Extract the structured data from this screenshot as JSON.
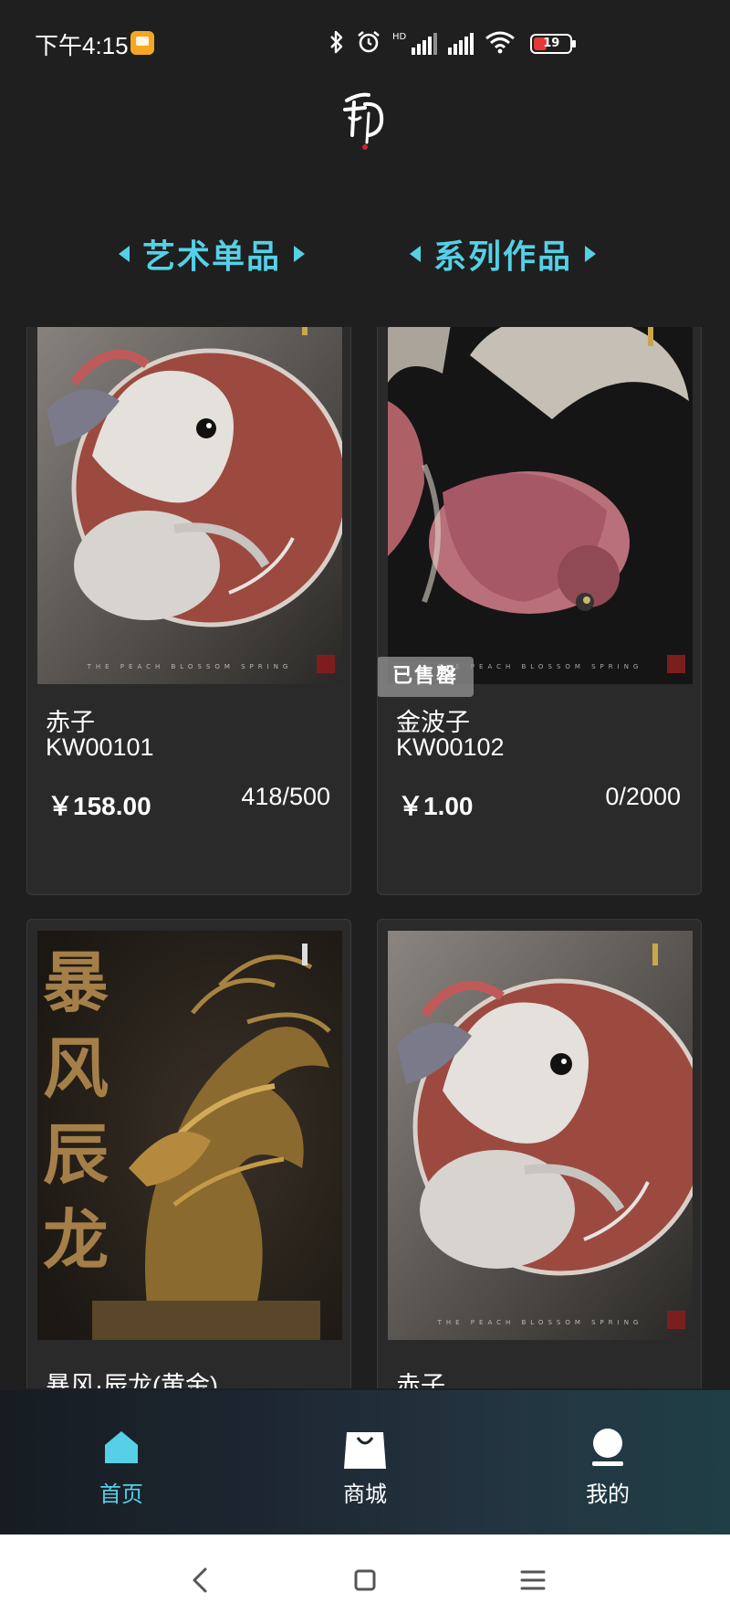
{
  "status_bar": {
    "time": "下午4:15",
    "hd_label": "HD",
    "battery_level": "19",
    "battery_color": "#e53935"
  },
  "tabs": [
    {
      "label": "艺术单品"
    },
    {
      "label": "系列作品"
    }
  ],
  "accent_color": "#55d0e6",
  "products": [
    {
      "name": "赤子",
      "code": "KW00101",
      "price": "￥158.00",
      "stock": "418/500",
      "image": "white-dragon-spirit-artwork"
    },
    {
      "name": "金波子",
      "code": "KW00102",
      "price": "￥1.00",
      "stock": "0/2000",
      "image": "goldfish-artwork",
      "badge": "已售罄"
    },
    {
      "name": "暴风·辰龙(黄金)",
      "image": "golden-dragon-artwork",
      "poster_text": "暴风辰龙"
    },
    {
      "name": "赤子",
      "image": "white-dragon-spirit-artwork"
    }
  ],
  "image_caption": "THE PEACH BLOSSOM SPRING",
  "bottom_nav": [
    {
      "label": "首页",
      "icon": "home-icon"
    },
    {
      "label": "商城",
      "icon": "shopping-bag-icon"
    },
    {
      "label": "我的",
      "icon": "profile-icon"
    }
  ],
  "system_nav": [
    "back-icon",
    "home-square-icon",
    "menu-icon"
  ]
}
